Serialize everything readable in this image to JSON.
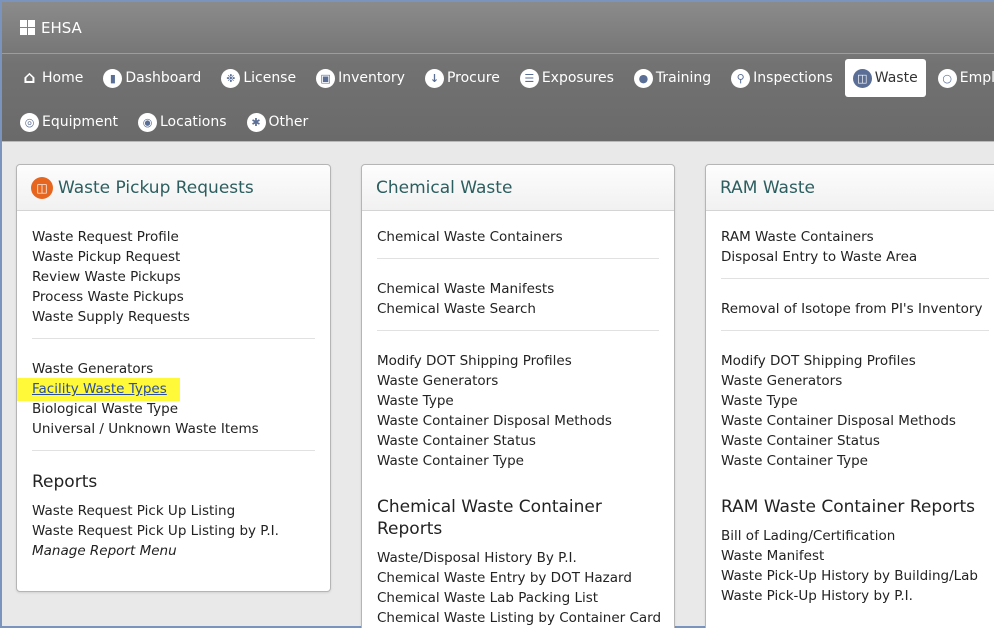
{
  "app": {
    "title": "EHSA"
  },
  "nav": {
    "row1": [
      {
        "label": "Home",
        "icon": "home-icon"
      },
      {
        "label": "Dashboard",
        "icon": "chart-icon"
      },
      {
        "label": "License",
        "icon": "wrench-icon"
      },
      {
        "label": "Inventory",
        "icon": "truck-icon"
      },
      {
        "label": "Procure",
        "icon": "download-icon"
      },
      {
        "label": "Exposures",
        "icon": "clipboard-icon"
      },
      {
        "label": "Training",
        "icon": "person-icon"
      },
      {
        "label": "Inspections",
        "icon": "magnifier-icon"
      },
      {
        "label": "Waste",
        "icon": "trash-icon",
        "active": true
      },
      {
        "label": "Employees",
        "icon": "group-icon"
      }
    ],
    "row2": [
      {
        "label": "Equipment",
        "icon": "disc-icon"
      },
      {
        "label": "Locations",
        "icon": "map-pin-icon"
      },
      {
        "label": "Other",
        "icon": "asterisk-icon"
      }
    ]
  },
  "panels": {
    "pickup": {
      "title": "Waste Pickup Requests",
      "groups": [
        [
          "Waste Request Profile",
          "Waste Pickup Request",
          "Review Waste Pickups",
          "Process Waste Pickups",
          "Waste Supply Requests"
        ],
        [
          "Waste Generators",
          "Facility Waste Types",
          "Biological Waste Type",
          "Universal / Unknown Waste Items"
        ]
      ],
      "reports_title": "Reports",
      "reports": [
        "Waste Request Pick Up Listing",
        "Waste Request Pick Up Listing by P.I."
      ],
      "manage": "Manage Report Menu"
    },
    "chemical": {
      "title": "Chemical Waste",
      "groups": [
        [
          "Chemical Waste Containers"
        ],
        [
          "Chemical Waste Manifests",
          "Chemical Waste Search"
        ],
        [
          "Modify DOT Shipping Profiles",
          "Waste Generators",
          "Waste Type",
          "Waste Container Disposal Methods",
          "Waste Container Status",
          "Waste Container Type"
        ]
      ],
      "reports_title": "Chemical Waste Container Reports",
      "reports": [
        "Waste/Disposal History By P.I.",
        "Chemical Waste Entry by DOT Hazard",
        "Chemical Waste Lab Packing List",
        "Chemical Waste Listing by Container Card"
      ]
    },
    "ram": {
      "title": "RAM Waste",
      "groups": [
        [
          "RAM Waste Containers",
          "Disposal Entry to Waste Area"
        ],
        [
          "Removal of Isotope from PI's Inventory"
        ],
        [
          "Modify DOT Shipping Profiles",
          "Waste Generators",
          "Waste Type",
          "Waste Container Disposal Methods",
          "Waste Container Status",
          "Waste Container Type"
        ]
      ],
      "reports_title": "RAM Waste Container Reports",
      "reports": [
        "Bill of Lading/Certification",
        "Waste Manifest",
        "Waste Pick-Up History by Building/Lab",
        "Waste Pick-Up History by P.I."
      ]
    }
  },
  "colors": {
    "accent": "#2d5e5f",
    "highlight": "#fff93a",
    "nav_bg": "#7a7a7a",
    "waste_icon": "#e7661f"
  }
}
